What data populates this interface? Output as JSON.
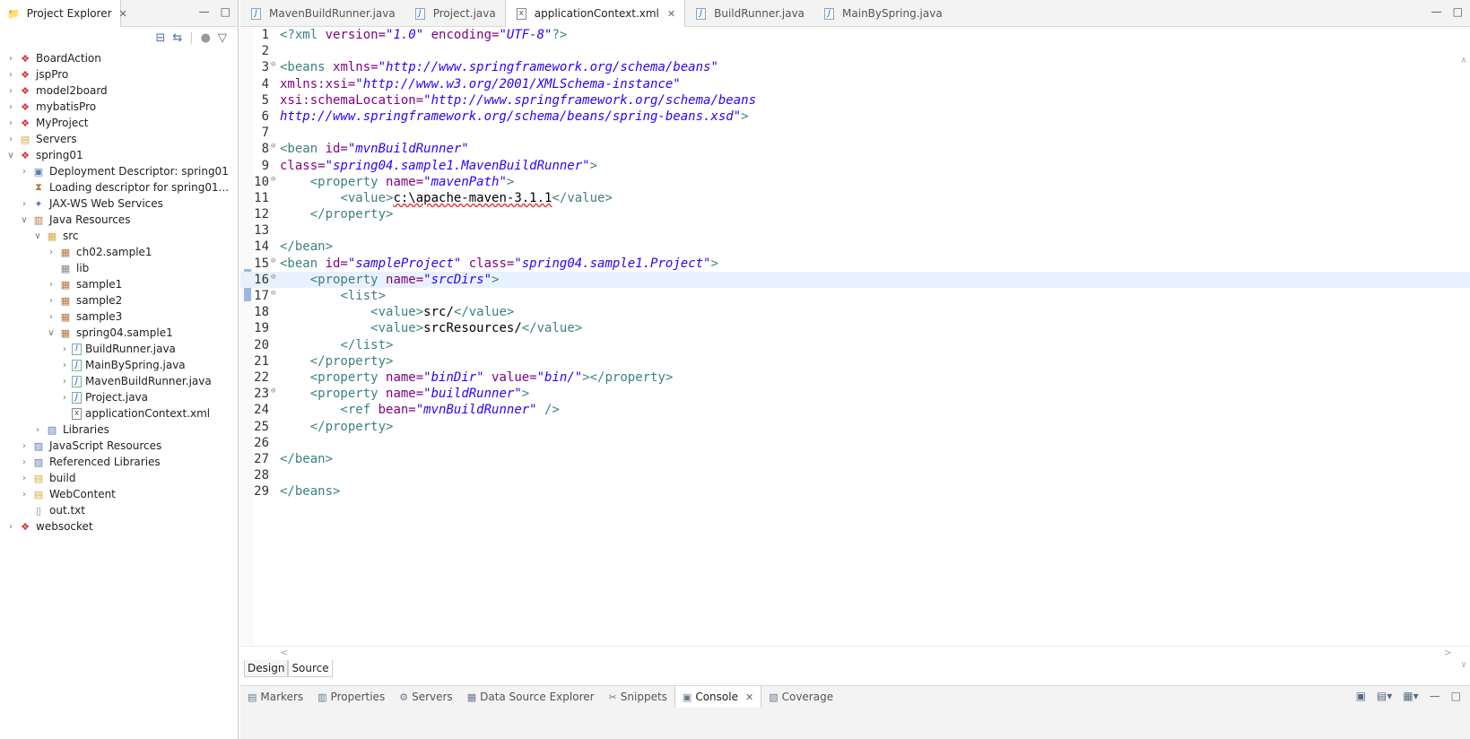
{
  "explorer": {
    "title": "Project Explorer",
    "tree": [
      {
        "label": "BoardAction",
        "depth": 0,
        "icon": "web-project-icon",
        "twisty": "collapsed"
      },
      {
        "label": "jspPro",
        "depth": 0,
        "icon": "web-project-icon",
        "twisty": "collapsed"
      },
      {
        "label": "model2board",
        "depth": 0,
        "icon": "web-project-icon",
        "twisty": "collapsed"
      },
      {
        "label": "mybatisPro",
        "depth": 0,
        "icon": "web-project-icon",
        "twisty": "collapsed"
      },
      {
        "label": "MyProject",
        "depth": 0,
        "icon": "web-project-icon",
        "twisty": "collapsed"
      },
      {
        "label": "Servers",
        "depth": 0,
        "icon": "folder-icon",
        "twisty": "collapsed"
      },
      {
        "label": "spring01",
        "depth": 0,
        "icon": "web-project-icon",
        "twisty": "expanded"
      },
      {
        "label": "Deployment Descriptor: spring01",
        "depth": 1,
        "icon": "descriptor-icon",
        "twisty": "collapsed"
      },
      {
        "label": "Loading descriptor for spring01...",
        "depth": 1,
        "icon": "loading-icon",
        "twisty": "none"
      },
      {
        "label": "JAX-WS Web Services",
        "depth": 1,
        "icon": "webservice-icon",
        "twisty": "collapsed"
      },
      {
        "label": "Java Resources",
        "depth": 1,
        "icon": "java-resources-icon",
        "twisty": "expanded"
      },
      {
        "label": "src",
        "depth": 2,
        "icon": "source-folder-icon",
        "twisty": "expanded"
      },
      {
        "label": "ch02.sample1",
        "depth": 3,
        "icon": "package-icon",
        "twisty": "collapsed"
      },
      {
        "label": "lib",
        "depth": 3,
        "icon": "empty-package-icon",
        "twisty": "none"
      },
      {
        "label": "sample1",
        "depth": 3,
        "icon": "package-icon",
        "twisty": "collapsed"
      },
      {
        "label": "sample2",
        "depth": 3,
        "icon": "package-icon",
        "twisty": "collapsed"
      },
      {
        "label": "sample3",
        "depth": 3,
        "icon": "package-icon",
        "twisty": "collapsed"
      },
      {
        "label": "spring04.sample1",
        "depth": 3,
        "icon": "package-icon",
        "twisty": "expanded"
      },
      {
        "label": "BuildRunner.java",
        "depth": 4,
        "icon": "java-interface-icon",
        "twisty": "collapsed"
      },
      {
        "label": "MainBySpring.java",
        "depth": 4,
        "icon": "java-file-icon",
        "twisty": "collapsed"
      },
      {
        "label": "MavenBuildRunner.java",
        "depth": 4,
        "icon": "java-file-icon",
        "twisty": "collapsed"
      },
      {
        "label": "Project.java",
        "depth": 4,
        "icon": "java-file-icon",
        "twisty": "collapsed"
      },
      {
        "label": "applicationContext.xml",
        "depth": 4,
        "icon": "xml-file-icon",
        "twisty": "none"
      },
      {
        "label": "Libraries",
        "depth": 2,
        "icon": "library-icon",
        "twisty": "collapsed"
      },
      {
        "label": "JavaScript Resources",
        "depth": 1,
        "icon": "library-icon",
        "twisty": "collapsed"
      },
      {
        "label": "Referenced Libraries",
        "depth": 1,
        "icon": "library-icon",
        "twisty": "collapsed"
      },
      {
        "label": "build",
        "depth": 1,
        "icon": "folder-icon",
        "twisty": "collapsed"
      },
      {
        "label": "WebContent",
        "depth": 1,
        "icon": "folder-icon",
        "twisty": "collapsed"
      },
      {
        "label": "out.txt",
        "depth": 1,
        "icon": "text-file-icon",
        "twisty": "none"
      },
      {
        "label": "websocket",
        "depth": 0,
        "icon": "web-project-icon",
        "twisty": "collapsed"
      }
    ]
  },
  "editor": {
    "tabs": [
      {
        "label": "MavenBuildRunner.java",
        "icon": "java-file-icon",
        "active": false
      },
      {
        "label": "Project.java",
        "icon": "java-file-icon",
        "active": false
      },
      {
        "label": "applicationContext.xml",
        "icon": "xml-file-icon",
        "active": true
      },
      {
        "label": "BuildRunner.java",
        "icon": "java-file-icon",
        "active": false
      },
      {
        "label": "MainBySpring.java",
        "icon": "java-file-icon",
        "active": false
      }
    ],
    "highlighted_line": 16,
    "lines": [
      {
        "n": "1",
        "fold": false,
        "tokens": [
          [
            "decl",
            "<?xml "
          ],
          [
            "attr",
            "version="
          ],
          [
            "val",
            "\"1.0\""
          ],
          [
            "txt",
            " "
          ],
          [
            "attr",
            "encoding="
          ],
          [
            "val",
            "\"UTF-8\""
          ],
          [
            "decl",
            "?>"
          ]
        ]
      },
      {
        "n": "2",
        "fold": false,
        "tokens": []
      },
      {
        "n": "3",
        "fold": true,
        "tokens": [
          [
            "tag",
            "<beans "
          ],
          [
            "attr",
            "xmlns="
          ],
          [
            "val",
            "\"http://www.springframework.org/schema/beans\""
          ]
        ]
      },
      {
        "n": "4",
        "fold": false,
        "tokens": [
          [
            "attr",
            "xmlns:xsi="
          ],
          [
            "val",
            "\"http://www.w3.org/2001/XMLSchema-instance\""
          ]
        ]
      },
      {
        "n": "5",
        "fold": false,
        "tokens": [
          [
            "attr",
            "xsi:schemaLocation="
          ],
          [
            "val",
            "\"http://www.springframework.org/schema/beans"
          ]
        ]
      },
      {
        "n": "6",
        "fold": false,
        "tokens": [
          [
            "val",
            "http://www.springframework.org/schema/beans/spring-beans.xsd\""
          ],
          [
            "tag",
            ">"
          ]
        ]
      },
      {
        "n": "7",
        "fold": false,
        "tokens": []
      },
      {
        "n": "8",
        "fold": true,
        "tokens": [
          [
            "tag",
            "<bean "
          ],
          [
            "attr",
            "id="
          ],
          [
            "val",
            "\"mvnBuildRunner\""
          ]
        ]
      },
      {
        "n": "9",
        "fold": false,
        "tokens": [
          [
            "attr",
            "class="
          ],
          [
            "val",
            "\"spring04.sample1.MavenBuildRunner\""
          ],
          [
            "tag",
            ">"
          ]
        ]
      },
      {
        "n": "10",
        "fold": true,
        "tokens": [
          [
            "txt",
            "    "
          ],
          [
            "tag",
            "<property "
          ],
          [
            "attr",
            "name="
          ],
          [
            "val",
            "\"mavenPath\""
          ],
          [
            "tag",
            ">"
          ]
        ]
      },
      {
        "n": "11",
        "fold": false,
        "tokens": [
          [
            "txt",
            "        "
          ],
          [
            "tag",
            "<value>"
          ],
          [
            "txt",
            "c:\\apache-maven-3.1.1"
          ],
          [
            "tag",
            "</value>"
          ]
        ]
      },
      {
        "n": "12",
        "fold": false,
        "tokens": [
          [
            "txt",
            "    "
          ],
          [
            "tag",
            "</property>"
          ]
        ]
      },
      {
        "n": "13",
        "fold": false,
        "tokens": []
      },
      {
        "n": "14",
        "fold": false,
        "tokens": [
          [
            "tag",
            "</bean>"
          ]
        ]
      },
      {
        "n": "15",
        "fold": true,
        "tokens": [
          [
            "tag",
            "<bean "
          ],
          [
            "attr",
            "id="
          ],
          [
            "val",
            "\"sampleProject\""
          ],
          [
            "txt",
            " "
          ],
          [
            "attr",
            "class="
          ],
          [
            "val",
            "\"spring04.sample1.Project\""
          ],
          [
            "tag",
            ">"
          ]
        ]
      },
      {
        "n": "16",
        "fold": true,
        "tokens": [
          [
            "txt",
            "    "
          ],
          [
            "tag",
            "<property "
          ],
          [
            "attr",
            "name="
          ],
          [
            "val",
            "\"srcDirs\""
          ],
          [
            "tag",
            ">"
          ]
        ]
      },
      {
        "n": "17",
        "fold": true,
        "tokens": [
          [
            "txt",
            "        "
          ],
          [
            "tag",
            "<list>"
          ]
        ]
      },
      {
        "n": "18",
        "fold": false,
        "tokens": [
          [
            "txt",
            "            "
          ],
          [
            "tag",
            "<value>"
          ],
          [
            "txt",
            "src/"
          ],
          [
            "tag",
            "</value>"
          ]
        ]
      },
      {
        "n": "19",
        "fold": false,
        "tokens": [
          [
            "txt",
            "            "
          ],
          [
            "tag",
            "<value>"
          ],
          [
            "txt",
            "srcResources/"
          ],
          [
            "tag",
            "</value>"
          ]
        ]
      },
      {
        "n": "20",
        "fold": false,
        "tokens": [
          [
            "txt",
            "        "
          ],
          [
            "tag",
            "</list>"
          ]
        ]
      },
      {
        "n": "21",
        "fold": false,
        "tokens": [
          [
            "txt",
            "    "
          ],
          [
            "tag",
            "</property>"
          ]
        ]
      },
      {
        "n": "22",
        "fold": false,
        "tokens": [
          [
            "txt",
            "    "
          ],
          [
            "tag",
            "<property "
          ],
          [
            "attr",
            "name="
          ],
          [
            "val",
            "\"binDir\""
          ],
          [
            "txt",
            " "
          ],
          [
            "attr",
            "value="
          ],
          [
            "val",
            "\"bin/\""
          ],
          [
            "tag",
            "></property>"
          ]
        ]
      },
      {
        "n": "23",
        "fold": true,
        "tokens": [
          [
            "txt",
            "    "
          ],
          [
            "tag",
            "<property "
          ],
          [
            "attr",
            "name="
          ],
          [
            "val",
            "\"buildRunner\""
          ],
          [
            "tag",
            ">"
          ]
        ]
      },
      {
        "n": "24",
        "fold": false,
        "tokens": [
          [
            "txt",
            "        "
          ],
          [
            "tag",
            "<ref "
          ],
          [
            "attr",
            "bean="
          ],
          [
            "val",
            "\"mvnBuildRunner\""
          ],
          [
            "txt",
            " "
          ],
          [
            "tag",
            "/>"
          ]
        ]
      },
      {
        "n": "25",
        "fold": false,
        "tokens": [
          [
            "txt",
            "    "
          ],
          [
            "tag",
            "</property>"
          ]
        ]
      },
      {
        "n": "26",
        "fold": false,
        "tokens": []
      },
      {
        "n": "27",
        "fold": false,
        "tokens": [
          [
            "tag",
            "</bean>"
          ]
        ]
      },
      {
        "n": "28",
        "fold": false,
        "tokens": []
      },
      {
        "n": "29",
        "fold": false,
        "tokens": [
          [
            "tag",
            "</beans>"
          ]
        ]
      }
    ],
    "bottom_tabs": {
      "design": "Design",
      "source": "Source"
    }
  },
  "bottom_panel": {
    "tabs": [
      {
        "label": "Markers",
        "icon": "markers-icon",
        "active": false
      },
      {
        "label": "Properties",
        "icon": "properties-icon",
        "active": false
      },
      {
        "label": "Servers",
        "icon": "servers-icon",
        "active": false
      },
      {
        "label": "Data Source Explorer",
        "icon": "data-source-icon",
        "active": false
      },
      {
        "label": "Snippets",
        "icon": "snippets-icon",
        "active": false
      },
      {
        "label": "Console",
        "icon": "console-icon",
        "active": true
      },
      {
        "label": "Coverage",
        "icon": "coverage-icon",
        "active": false
      }
    ]
  },
  "colors": {
    "tag": "#3f7f7f",
    "attr": "#7f007f",
    "val": "#2a00ff",
    "highlight": "#e8f2fe"
  }
}
